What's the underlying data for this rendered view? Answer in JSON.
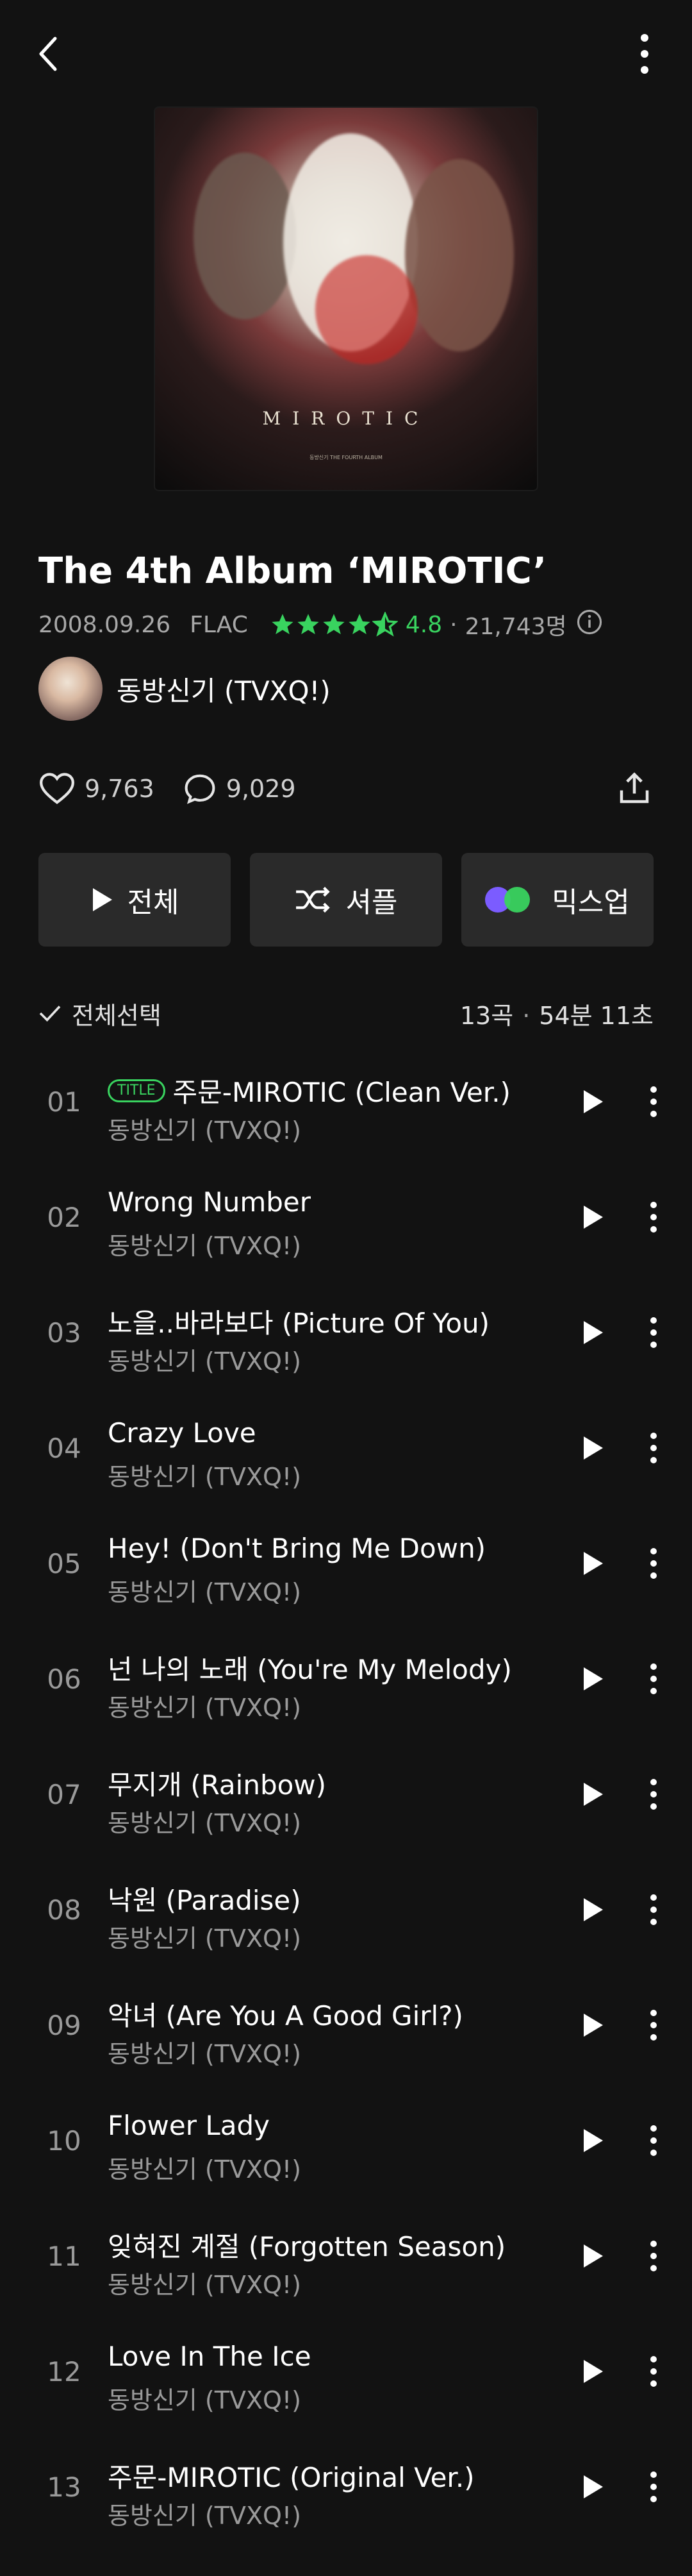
{
  "album": {
    "title": "The 4th Album ‘MIROTIC’",
    "date": "2008.09.26",
    "format": "FLAC",
    "rating": "4.8",
    "rating_count": "21,743명",
    "cover_text": "MIROTIC",
    "cover_subtext": "동방신기 THE FOURTH ALBUM"
  },
  "artist": {
    "name": "동방신기 (TVXQ!)"
  },
  "stats": {
    "likes": "9,763",
    "comments": "9,029"
  },
  "actions": {
    "play_all": "전체",
    "shuffle": "셔플",
    "mixup": "믹스업"
  },
  "list_header": {
    "select_all": "전체선택",
    "count": "13곡",
    "duration": "54분 11초"
  },
  "title_badge": "TITLE",
  "colors": {
    "accent": "#39d35f",
    "background": "#121212",
    "button": "#2a2a2a"
  },
  "tracks": [
    {
      "no": "01",
      "title": "주문-MIROTIC (Clean Ver.)",
      "artist": "동방신기 (TVXQ!)"
    },
    {
      "no": "02",
      "title": "Wrong Number",
      "artist": "동방신기 (TVXQ!)"
    },
    {
      "no": "03",
      "title": "노을..바라보다 (Picture Of You)",
      "artist": "동방신기 (TVXQ!)"
    },
    {
      "no": "04",
      "title": "Crazy Love",
      "artist": "동방신기 (TVXQ!)"
    },
    {
      "no": "05",
      "title": "Hey! (Don't Bring Me Down)",
      "artist": "동방신기 (TVXQ!)"
    },
    {
      "no": "06",
      "title": "넌 나의 노래 (You're My Melody)",
      "artist": "동방신기 (TVXQ!)"
    },
    {
      "no": "07",
      "title": "무지개 (Rainbow)",
      "artist": "동방신기 (TVXQ!)"
    },
    {
      "no": "08",
      "title": "낙원 (Paradise)",
      "artist": "동방신기 (TVXQ!)"
    },
    {
      "no": "09",
      "title": "악녀 (Are You A Good Girl?)",
      "artist": "동방신기 (TVXQ!)"
    },
    {
      "no": "10",
      "title": "Flower Lady",
      "artist": "동방신기 (TVXQ!)"
    },
    {
      "no": "11",
      "title": "잊혀진 계절 (Forgotten Season)",
      "artist": "동방신기 (TVXQ!)"
    },
    {
      "no": "12",
      "title": "Love In The Ice",
      "artist": "동방신기 (TVXQ!)"
    },
    {
      "no": "13",
      "title": "주문-MIROTIC (Original Ver.)",
      "artist": "동방신기 (TVXQ!)"
    }
  ]
}
